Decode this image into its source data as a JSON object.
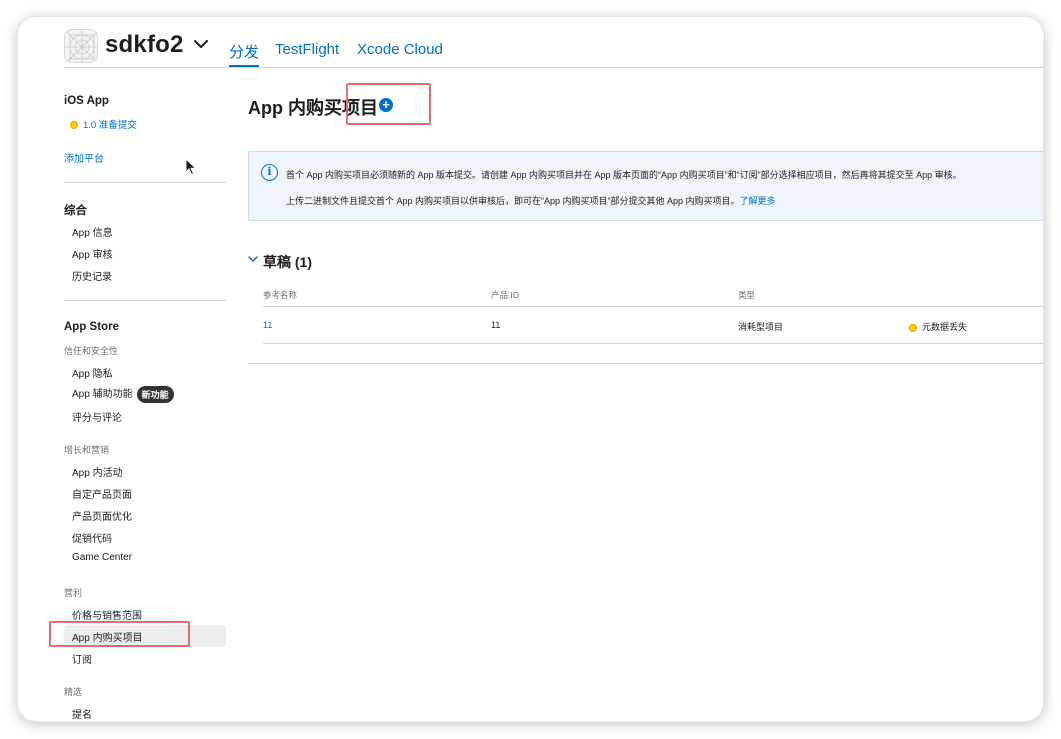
{
  "header": {
    "app_name": "sdkfo2",
    "tabs": [
      {
        "label": "分发",
        "active": true
      },
      {
        "label": "TestFlight",
        "active": false
      },
      {
        "label": "Xcode Cloud",
        "active": false
      }
    ]
  },
  "sidebar": {
    "platform": "iOS App",
    "version_status": "1.0 准备提交",
    "add_platform": "添加平台",
    "general": {
      "title": "综合",
      "items": [
        "App 信息",
        "App 审核",
        "历史记录"
      ]
    },
    "app_store": {
      "title": "App Store",
      "trust_group": "信任和安全性",
      "trust_items": [
        "App 隐私",
        "App 辅助功能",
        "评分与评论"
      ],
      "new_badge": "新功能",
      "growth_group": "增长和营销",
      "growth_items": [
        "App 内活动",
        "自定产品页面",
        "产品页面优化",
        "促销代码",
        "Game Center"
      ],
      "monetize_group": "营利",
      "monetize_items": [
        "价格与销售范围",
        "App 内购买项目",
        "订阅"
      ],
      "featured_group": "精选",
      "featured_items": [
        "提名"
      ]
    }
  },
  "main": {
    "title": "App 内购买项目",
    "add_button_glyph": "+",
    "info": {
      "line1": "首个 App 内购买项目必须随新的 App 版本提交。请创建 App 内购买项目并在 App 版本页面的“App 内购买项目”和“订阅”部分选择相应项目，然后再将其提交至 App 审核。",
      "line2": "上传二进制文件且提交首个 App 内购买项目以供审核后，即可在“App 内购买项目”部分提交其他 App 内购买项目。",
      "learn_more": "了解更多"
    },
    "drafts": {
      "title": "草稿 (1)",
      "columns": [
        "参考名称",
        "产品 ID",
        "类型"
      ],
      "rows": [
        {
          "name": "11",
          "product_id": "11",
          "type": "消耗型项目",
          "status": "元数据丢失"
        }
      ]
    }
  },
  "colors": {
    "accent": "#0070c9",
    "highlight": "#ec6b6b",
    "status_yellow": "#ffcc00"
  }
}
